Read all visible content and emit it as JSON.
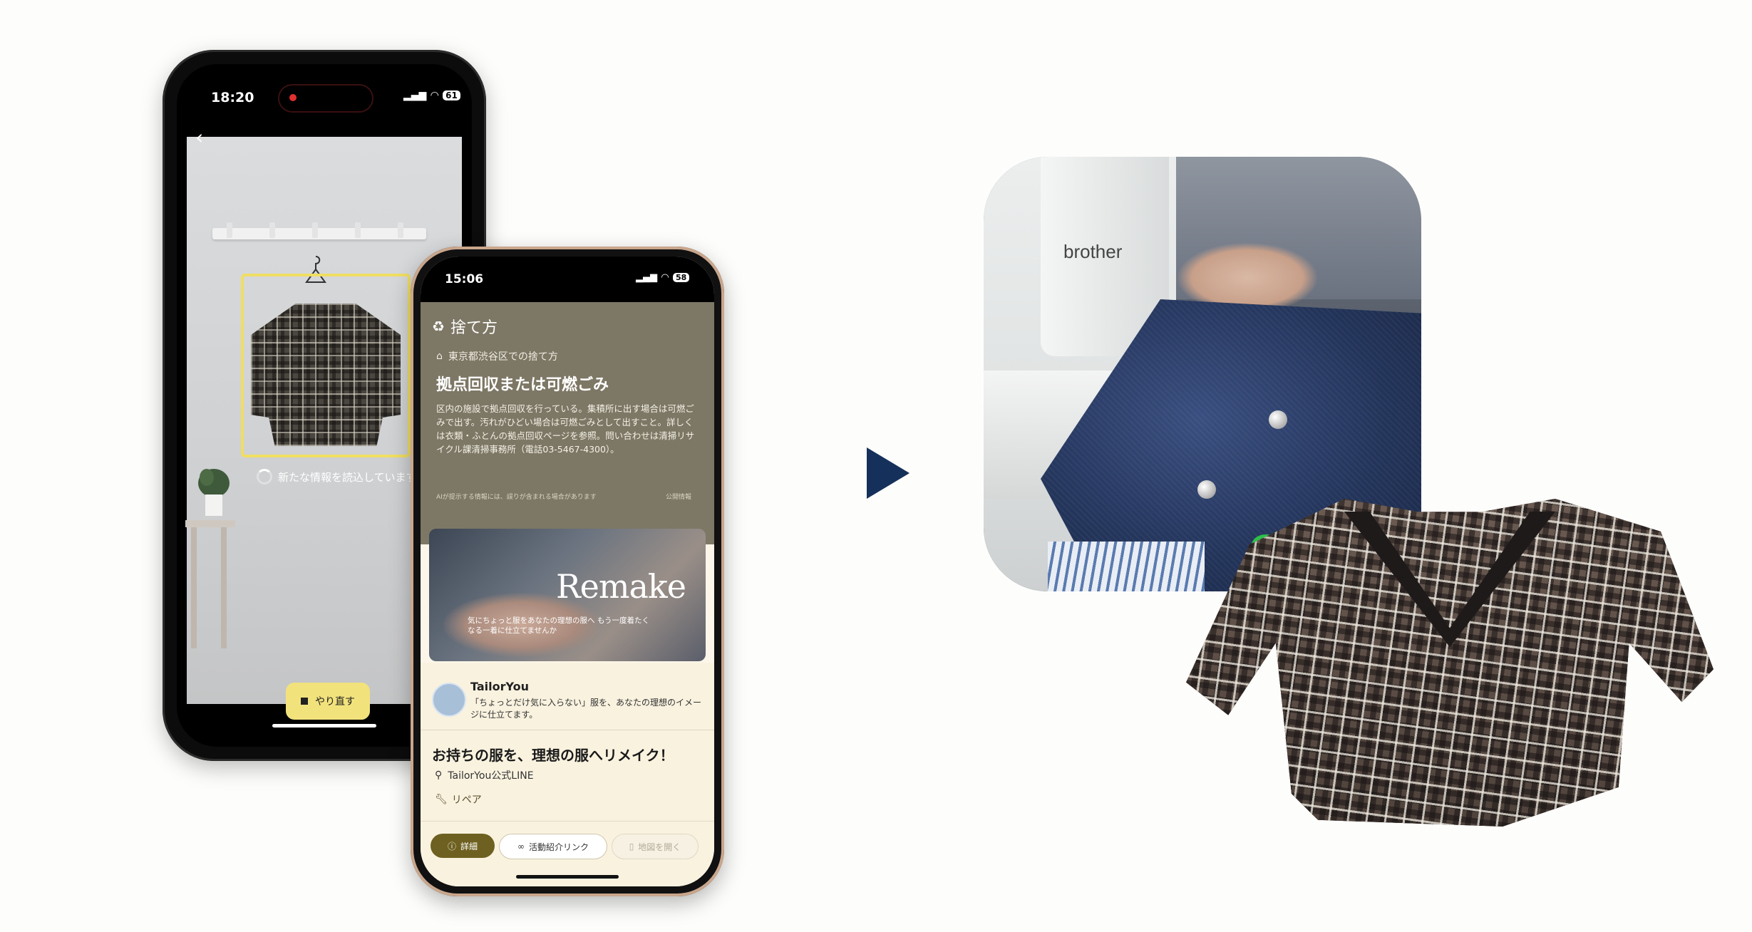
{
  "phone1": {
    "status": {
      "time": "18:20",
      "battery": "61"
    },
    "scan_text": "新たな情報を読込しています",
    "retry_label": "やり直す"
  },
  "phone2": {
    "status": {
      "time": "15:06",
      "battery": "58"
    },
    "header": {
      "icon": "recycle-icon",
      "title": "捨て方"
    },
    "location": "東京都渋谷区での捨て方",
    "method": "拠点回収または可燃ごみ",
    "description": "区内の施設で拠点回収を行っている。集積所に出す場合は可燃ごみで出す。汚れがひどい場合は可燃ごみとして出すこと。詳しくは衣類・ふとんの拠点回収ページを参照。問い合わせは清掃リサイクル課清掃事務所（電話03-5467-4300）。",
    "note": "AIが提示する情報には、誤りが含まれる場合があります",
    "note_right": "公開情報",
    "banner": {
      "title": "Remake",
      "subtitle": "気にちょっと服をあなたの理想の服へ もう一度着たくなる一着に仕立てませんか"
    },
    "org": {
      "name": "TailorYou",
      "description": "「ちょっとだけ気に入らない」服を、あなたの理想のイメージに仕立てます。"
    },
    "headline": "お持ちの服を、理想の服へリメイク！",
    "line_account": "TailorYou公式LINE",
    "tag": "リペア",
    "buttons": {
      "detail": "詳細",
      "link": "活動紹介リンク",
      "map": "地図を開く"
    }
  },
  "photo": {
    "brand": "brother"
  },
  "colors": {
    "accent_yellow": "#f2e27c",
    "arrow_navy": "#15305a",
    "detail_button": "#6e6020"
  }
}
